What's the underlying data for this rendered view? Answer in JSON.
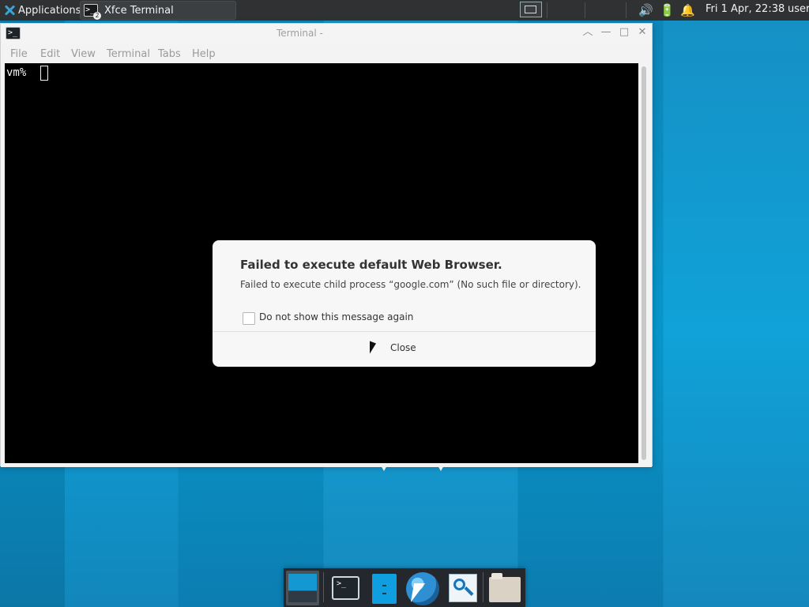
{
  "top_panel": {
    "applications_label": "Applications",
    "task_label": "Xfce Terminal",
    "task_badge": "2",
    "clock_label": "Fri  1 Apr, 22:38",
    "user_label": "user"
  },
  "window": {
    "title": "Terminal -",
    "menu": [
      "File",
      "Edit",
      "View",
      "Terminal",
      "Tabs",
      "Help"
    ],
    "prompt": "vm%"
  },
  "dialog": {
    "title": "Failed to execute default Web Browser.",
    "message": "Failed to execute child process “google.com” (No such file or directory).",
    "checkbox_label": "Do not show this message again",
    "close_label": "Close"
  },
  "icons": {
    "applications": "xfce-logo-icon",
    "terminal": "terminal-icon",
    "speaker": "speaker-icon",
    "battery": "battery-icon",
    "notifications": "bell-icon",
    "show_desktop": "show-desktop-icon",
    "dock_desktop": "desktop-icon",
    "dock_terminal": "terminal-icon",
    "dock_files": "file-manager-icon",
    "dock_web": "web-browser-icon",
    "dock_search": "search-icon",
    "dock_folder": "folder-icon"
  },
  "colors": {
    "desktop_blue": "#0a94c8",
    "panel_dark": "#2f3133",
    "terminal_bg": "#000000",
    "dialog_bg": "#f7f7f7"
  }
}
